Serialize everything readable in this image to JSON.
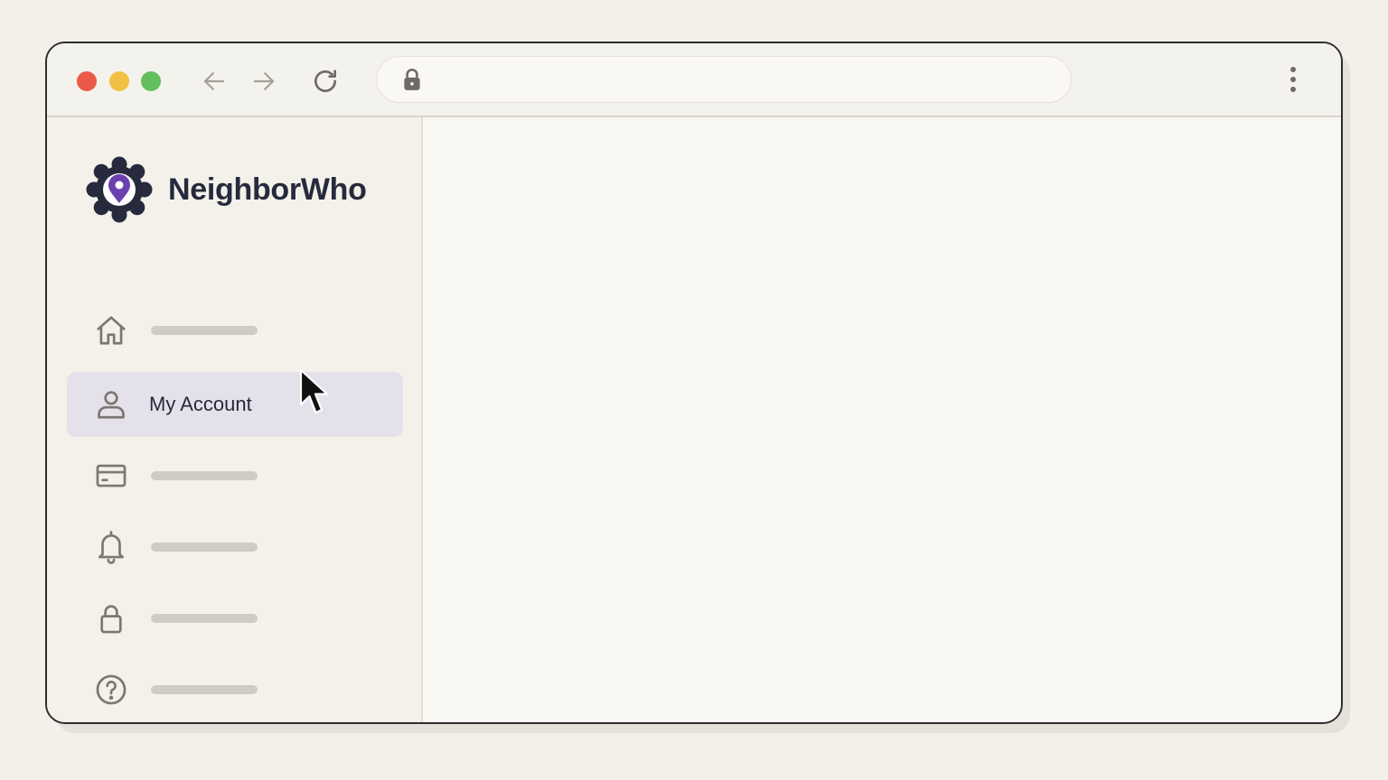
{
  "browser": {
    "controls": {
      "close_color": "#ea5a4a",
      "minimize_color": "#f2bf45",
      "maximize_color": "#63be5e"
    },
    "icons": [
      "arrow-left-icon",
      "arrow-right-icon",
      "reload-icon",
      "lock-icon",
      "kebab-menu-icon"
    ],
    "address_value": ""
  },
  "app": {
    "name": "NeighborWho",
    "logo_icon": "gear-location-pin-logo",
    "brand_colors": {
      "primary_dark": "#262a3c",
      "accent_purple": "#6a3fb0"
    }
  },
  "sidebar": {
    "items": [
      {
        "icon": "home-icon",
        "label": "",
        "active": false
      },
      {
        "icon": "user-icon",
        "label": "My Account",
        "active": true
      },
      {
        "icon": "credit-card-icon",
        "label": "",
        "active": false
      },
      {
        "icon": "bell-icon",
        "label": "",
        "active": false
      },
      {
        "icon": "lock-icon",
        "label": "",
        "active": false
      },
      {
        "icon": "help-circle-icon",
        "label": "",
        "active": false
      }
    ],
    "active_bg": "#e5e1ea"
  },
  "cursor": {
    "icon": "mouse-pointer-icon"
  }
}
